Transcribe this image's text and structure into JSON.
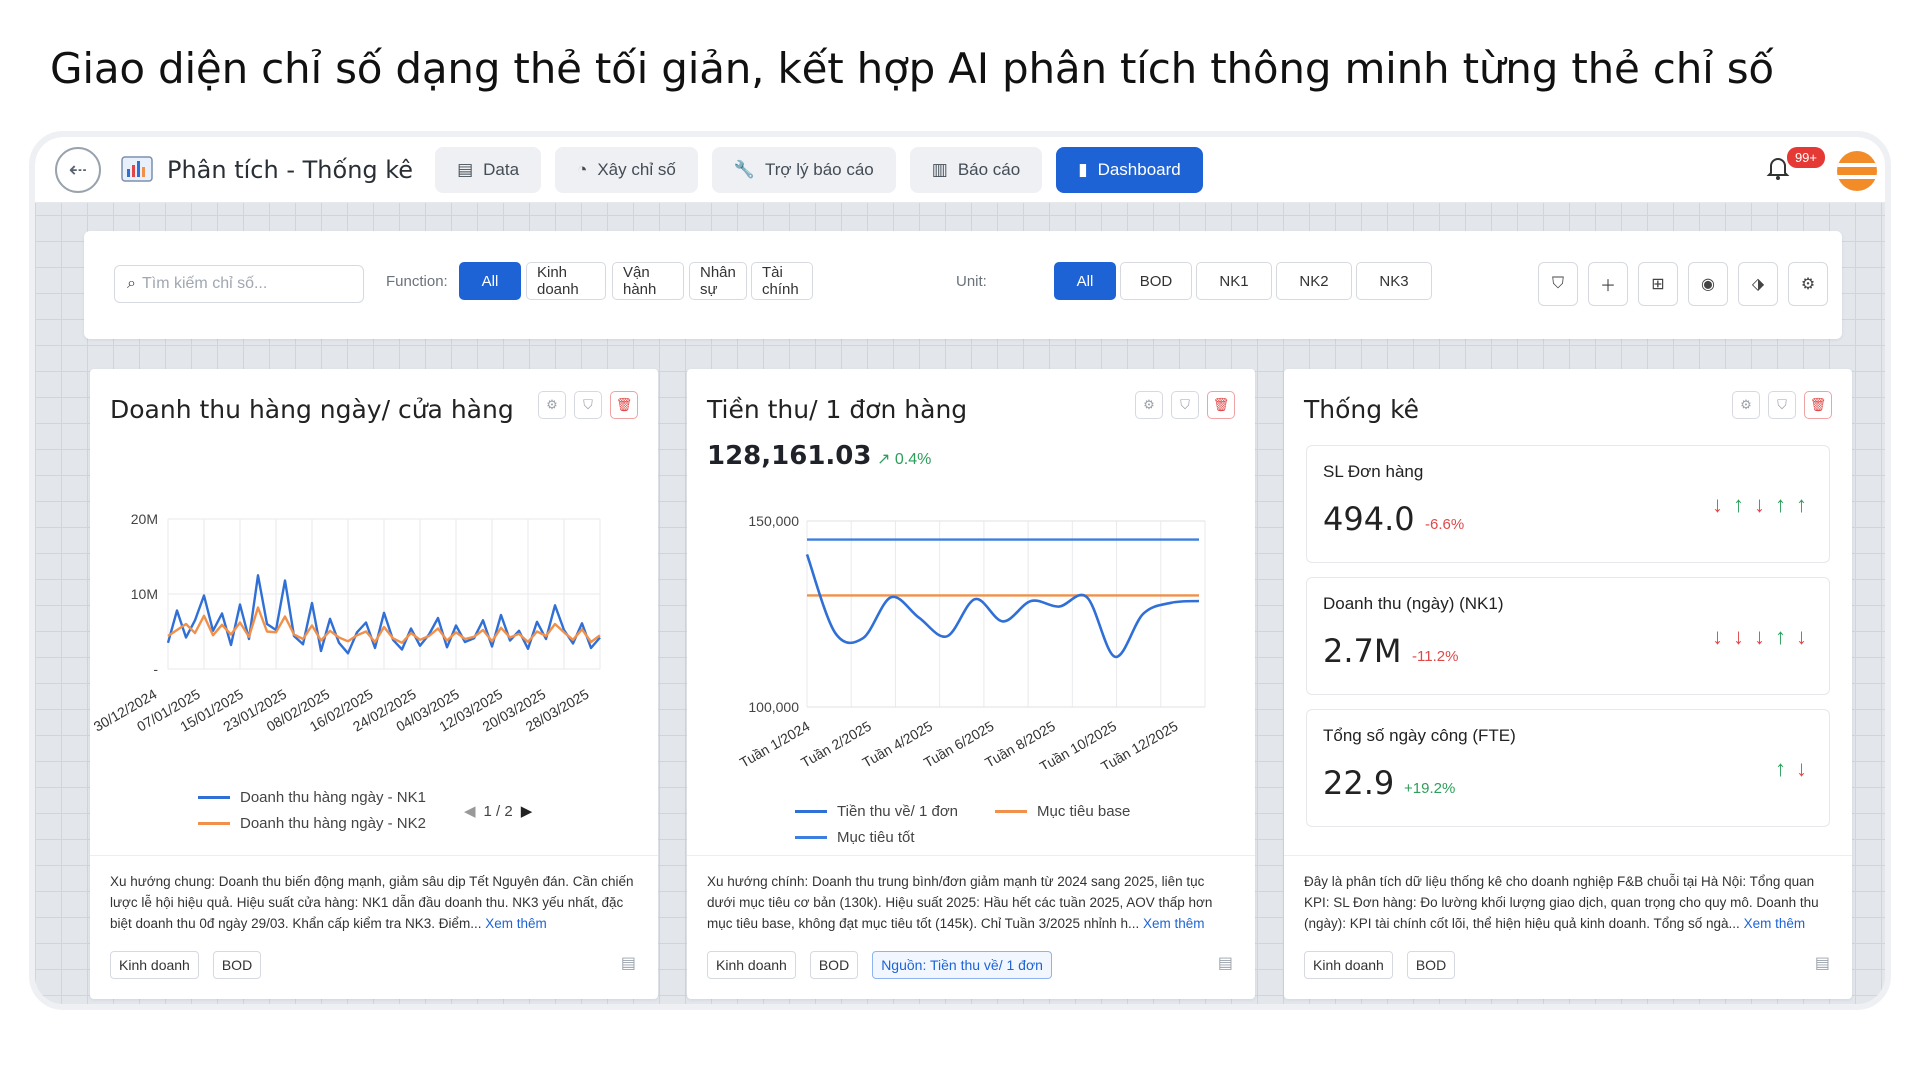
{
  "headline": "Giao diện chỉ số dạng thẻ tối giản, kết hợp AI phân tích thông minh từng thẻ chỉ số",
  "app": {
    "title": "Phân tích - Thống kê"
  },
  "nav": {
    "tabs": [
      {
        "label": "Data",
        "icon": "document-icon"
      },
      {
        "label": "Xây chỉ số",
        "icon": "pie-icon"
      },
      {
        "label": "Trợ lý báo cáo",
        "icon": "wrench-icon"
      },
      {
        "label": "Báo cáo",
        "icon": "bar-chart-icon"
      },
      {
        "label": "Dashboard",
        "icon": "dashboard-icon",
        "active": true
      }
    ],
    "notification_badge": "99+"
  },
  "filters": {
    "search_placeholder": "Tìm kiếm chỉ số...",
    "function_label": "Function:",
    "functions": [
      "All",
      "Kinh doanh",
      "Vận hành",
      "Nhân sự",
      "Tài chính"
    ],
    "unit_label": "Unit:",
    "units": [
      "All",
      "BOD",
      "NK1",
      "NK2",
      "NK3"
    ]
  },
  "cards": [
    {
      "title": "Doanh thu hàng ngày/ cửa hàng",
      "description": "Xu hướng chung: Doanh thu biến động mạnh, giảm sâu dịp Tết Nguyên đán. Cần chiến lược lễ hội hiệu quả. Hiệu suất cửa hàng: NK1 dẫn đầu doanh thu. NK3 yếu nhất, đặc biệt doanh thu 0đ ngày 29/03. Khẩn cấp kiểm tra NK3. Điểm...",
      "more": "Xem thêm",
      "tags": [
        "Kinh doanh",
        "BOD"
      ],
      "pager": "1 / 2"
    },
    {
      "title": "Tiền thu/ 1 đơn hàng",
      "value": "128,161.03",
      "change": "↗ 0.4%",
      "description": "Xu hướng chính: Doanh thu trung bình/đơn giảm mạnh từ 2024 sang 2025, liên tục dưới mục tiêu cơ bản (130k). Hiệu suất 2025: Hầu hết các tuần 2025, AOV thấp hơn mục tiêu base, không đạt mục tiêu tốt (145k). Chỉ Tuần 3/2025 nhỉnh h...",
      "more": "Xem thêm",
      "tags": [
        "Kinh doanh",
        "BOD"
      ],
      "source_tag": "Nguồn: Tiền thu về/ 1 đơn"
    },
    {
      "title": "Thống kê",
      "description": "Đây là phân tích dữ liệu thống kê cho doanh nghiệp F&B chuỗi tại Hà Nội: Tổng quan KPI: SL Đơn hàng: Đo lường khối lượng giao dịch, quan trọng cho quy mô. Doanh thu (ngày): KPI tài chính cốt lõi, thể hiện hiệu quả kinh doanh. Tổng số ngà...",
      "more": "Xem thêm",
      "tags": [
        "Kinh doanh",
        "BOD"
      ],
      "kpis": [
        {
          "label": "SL Đơn hàng",
          "value": "494.0",
          "change": "-6.6%",
          "trend": "down",
          "arrows": [
            "down",
            "up",
            "down",
            "up",
            "up"
          ]
        },
        {
          "label": "Doanh thu (ngày) (NK1)",
          "value": "2.7M",
          "change": "-11.2%",
          "trend": "down",
          "arrows": [
            "down",
            "down",
            "down",
            "up",
            "down"
          ]
        },
        {
          "label": "Tổng số ngày công (FTE)",
          "value": "22.9",
          "change": "+19.2%",
          "trend": "up",
          "arrows": [
            "up",
            "down"
          ]
        }
      ]
    }
  ],
  "chart_data": [
    {
      "type": "line",
      "title": "Doanh thu hàng ngày/ cửa hàng",
      "y_ticks": [
        "20M",
        "10M",
        "-"
      ],
      "ylim": [
        0,
        20000000
      ],
      "x_tick_labels": [
        "30/12/2024",
        "07/01/2025",
        "15/01/2025",
        "23/01/2025",
        "08/02/2025",
        "16/02/2025",
        "24/02/2025",
        "04/03/2025",
        "12/03/2025",
        "20/03/2025",
        "28/03/2025"
      ],
      "series": [
        {
          "name": "Doanh thu hàng ngày - NK1",
          "color": "#2f6fd6",
          "values": [
            3.5,
            7.8,
            4.2,
            6.5,
            9.8,
            5.1,
            7.4,
            3.2,
            8.6,
            4.0,
            12.5,
            6.0,
            5.2,
            11.8,
            4.4,
            3.3,
            8.8,
            2.4,
            6.7,
            3.5,
            2.1,
            4.9,
            6.2,
            2.8,
            7.5,
            3.9,
            2.6,
            5.4,
            3.1,
            4.6,
            6.8,
            2.9,
            5.8,
            3.6,
            4.1,
            6.5,
            3.0,
            7.2,
            3.8,
            5.1,
            2.7,
            6.3,
            4.0,
            8.5,
            5.2,
            3.4,
            6.1,
            2.8,
            4.2
          ]
        },
        {
          "name": "Doanh thu hàng ngày - NK2",
          "color": "#f0904a",
          "values": [
            4.4,
            5.2,
            6.0,
            4.8,
            7.1,
            4.5,
            5.9,
            4.6,
            6.2,
            4.3,
            8.2,
            5.0,
            4.9,
            7.0,
            4.6,
            4.0,
            5.8,
            3.8,
            5.1,
            4.2,
            3.7,
            4.5,
            5.0,
            3.6,
            5.6,
            4.1,
            3.5,
            4.8,
            3.9,
            4.4,
            5.4,
            3.8,
            4.9,
            4.0,
            4.3,
            5.2,
            3.7,
            5.5,
            4.2,
            4.7,
            3.6,
            5.0,
            4.4,
            6.0,
            4.9,
            3.9,
            5.3,
            3.6,
            4.5
          ]
        }
      ]
    },
    {
      "type": "line",
      "title": "Tiền thu/ 1 đơn hàng",
      "y_ticks": [
        "150,000",
        "100,000"
      ],
      "ylim": [
        100000,
        150000
      ],
      "x_tick_labels": [
        "Tuần 1/2024",
        "Tuần 2/2025",
        "Tuần 4/2025",
        "Tuần 6/2025",
        "Tuần 8/2025",
        "Tuần 10/2025",
        "Tuần 12/2025"
      ],
      "series": [
        {
          "name": "Tiền thu về/ 1 đơn",
          "color": "#2f6fd6",
          "values": [
            141000,
            120000,
            118500,
            129500,
            124000,
            119000,
            129000,
            123000,
            128500,
            127000,
            129500,
            113500,
            125000,
            128000,
            128500
          ]
        },
        {
          "name": "Mục tiêu base",
          "color": "#f0904a",
          "values": [
            130000,
            130000
          ]
        },
        {
          "name": "Mục tiêu tốt",
          "color": "#3d7fe0",
          "values": [
            145000,
            145000
          ]
        }
      ]
    }
  ]
}
